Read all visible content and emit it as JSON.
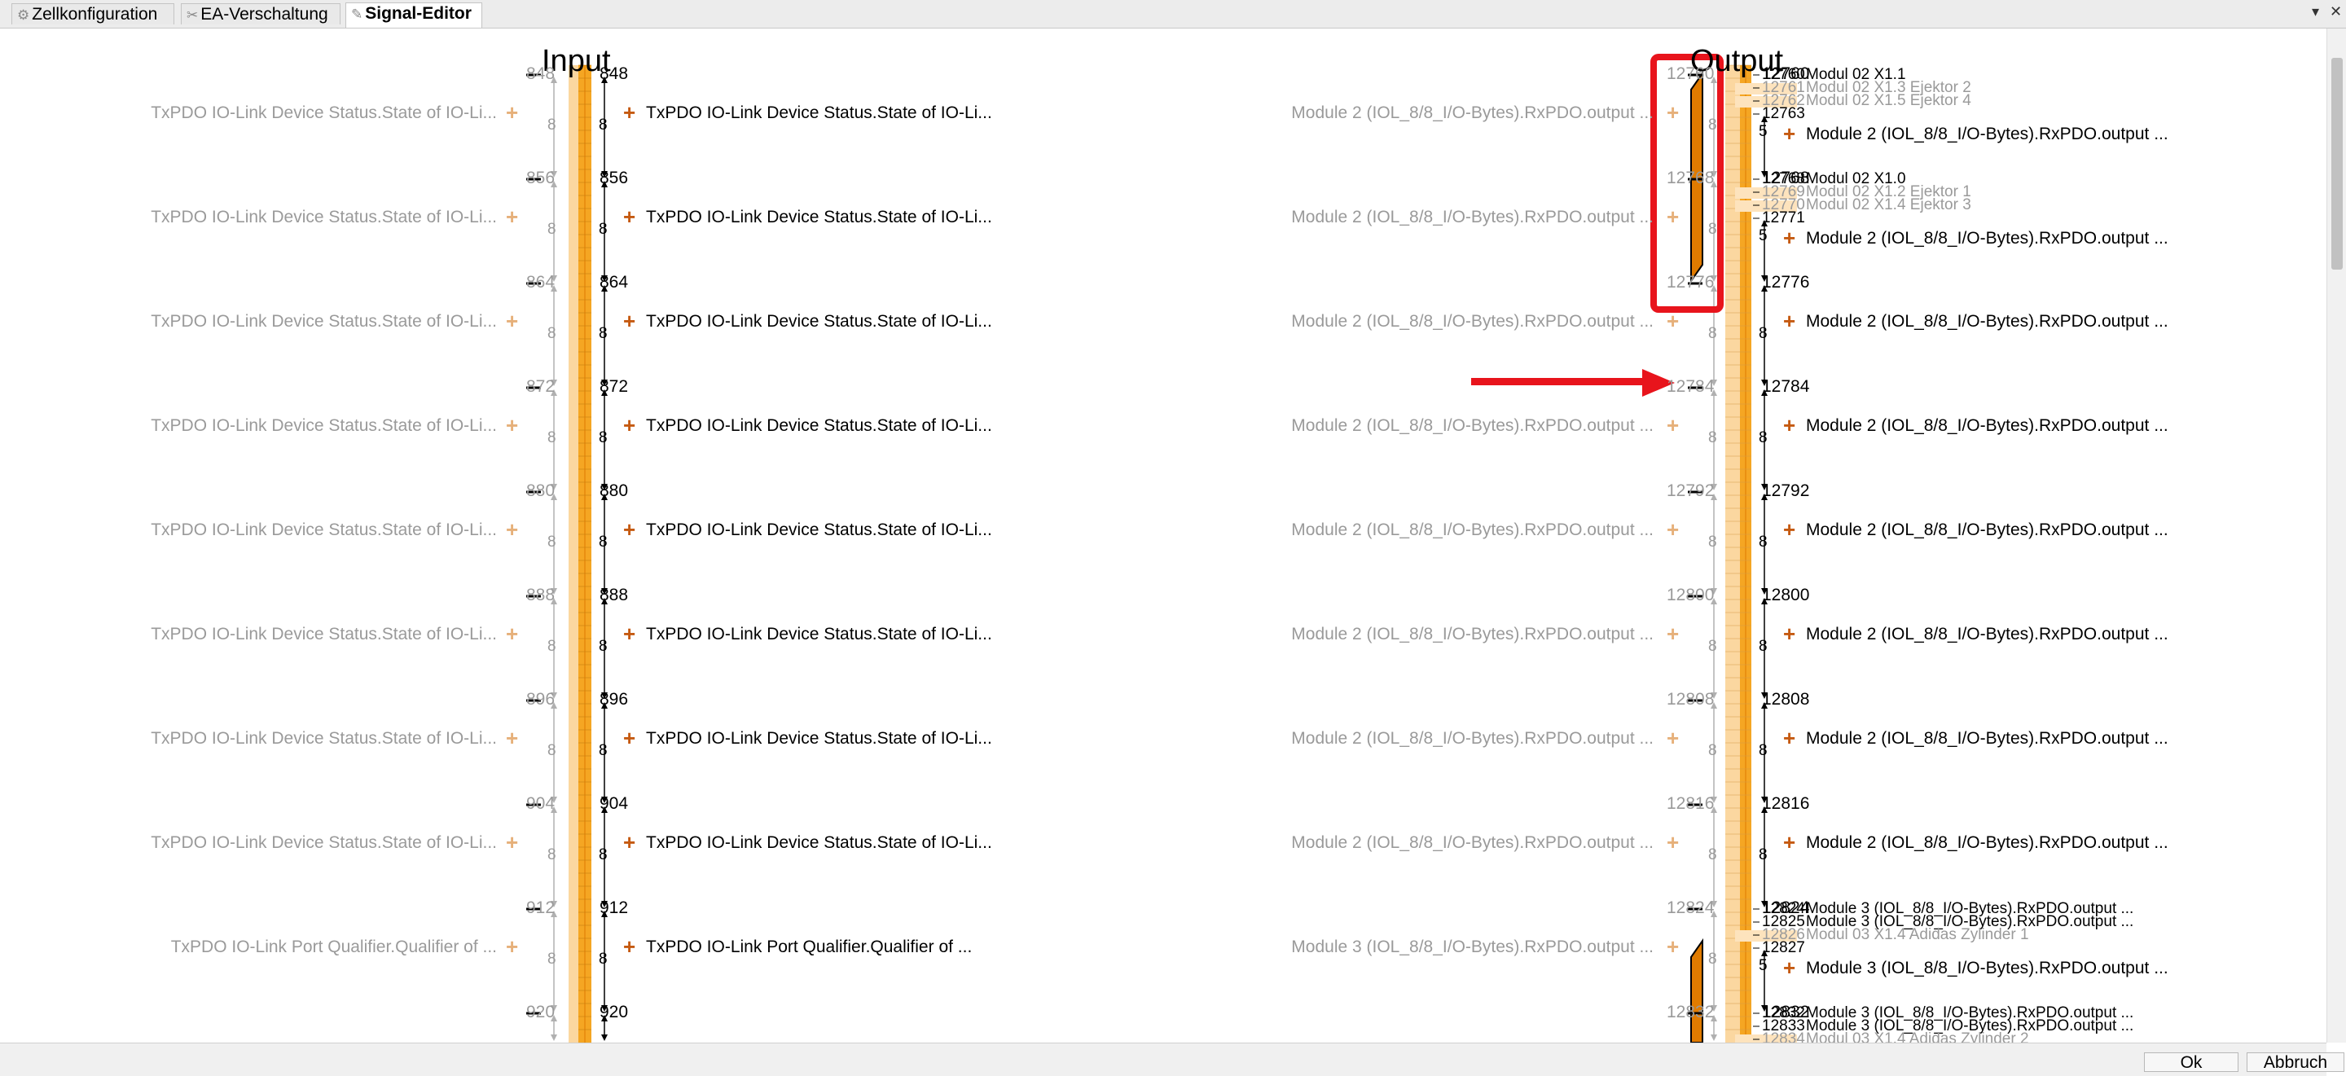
{
  "tabs": [
    {
      "icon": "⚙",
      "label": "Zellkonfiguration"
    },
    {
      "icon": "✂",
      "label": "EA-Verschaltung"
    },
    {
      "icon": "✎",
      "label": "Signal-Editor"
    }
  ],
  "window_controls": {
    "collapse": "▾",
    "close": "✕"
  },
  "headers": {
    "input": "Input",
    "output": "Output"
  },
  "input_rows": [
    {
      "start": "848",
      "width": "8",
      "left": "TxPDO IO-Link Device Status.State of IO-Li...",
      "right": "TxPDO IO-Link Device Status.State of IO-Li..."
    },
    {
      "start": "856",
      "width": "8",
      "left": "TxPDO IO-Link Device Status.State of IO-Li...",
      "right": "TxPDO IO-Link Device Status.State of IO-Li..."
    },
    {
      "start": "864",
      "width": "8",
      "left": "TxPDO IO-Link Device Status.State of IO-Li...",
      "right": "TxPDO IO-Link Device Status.State of IO-Li..."
    },
    {
      "start": "872",
      "width": "8",
      "left": "TxPDO IO-Link Device Status.State of IO-Li...",
      "right": "TxPDO IO-Link Device Status.State of IO-Li..."
    },
    {
      "start": "880",
      "width": "8",
      "left": "TxPDO IO-Link Device Status.State of IO-Li...",
      "right": "TxPDO IO-Link Device Status.State of IO-Li..."
    },
    {
      "start": "888",
      "width": "8",
      "left": "TxPDO IO-Link Device Status.State of IO-Li...",
      "right": "TxPDO IO-Link Device Status.State of IO-Li..."
    },
    {
      "start": "896",
      "width": "8",
      "left": "TxPDO IO-Link Device Status.State of IO-Li...",
      "right": "TxPDO IO-Link Device Status.State of IO-Li..."
    },
    {
      "start": "904",
      "width": "8",
      "left": "TxPDO IO-Link Device Status.State of IO-Li...",
      "right": "TxPDO IO-Link Device Status.State of IO-Li..."
    },
    {
      "start": "912",
      "width": "8",
      "left": "TxPDO IO-Link Port Qualifier.Qualifier of ...",
      "right": "TxPDO IO-Link Port Qualifier.Qualifier of ..."
    },
    {
      "start": "920",
      "width": "",
      "left": "",
      "right": ""
    }
  ],
  "output_rows": [
    {
      "start": "12760",
      "width": "8",
      "left": "Module 2 (IOL_8/8_I/O-Bytes).RxPDO.output ...",
      "right_width": "5",
      "right": "Module 2 (IOL_8/8_I/O-Bytes).RxPDO.output ...",
      "bits": [
        {
          "n": "12760",
          "label": "Modul 02 X1.1",
          "dim": false
        },
        {
          "n": "12761",
          "label": "Modul 02 X1.3 Ejektor 2",
          "dim": true
        },
        {
          "n": "12762",
          "label": "Modul 02 X1.5 Ejektor 4",
          "dim": true
        },
        {
          "n": "12763",
          "label": "",
          "dim": false
        }
      ]
    },
    {
      "start": "12768",
      "width": "8",
      "left": "Module 2 (IOL_8/8_I/O-Bytes).RxPDO.output ...",
      "right_width": "5",
      "right": "Module 2 (IOL_8/8_I/O-Bytes).RxPDO.output ...",
      "bits": [
        {
          "n": "12768",
          "label": "Modul 02 X1.0",
          "dim": false
        },
        {
          "n": "12769",
          "label": "Modul 02 X1.2 Ejektor 1",
          "dim": true
        },
        {
          "n": "12770",
          "label": "Modul 02 X1.4 Ejektor 3",
          "dim": true
        },
        {
          "n": "12771",
          "label": "",
          "dim": false
        }
      ]
    },
    {
      "start": "12776",
      "width": "8",
      "left": "Module 2 (IOL_8/8_I/O-Bytes).RxPDO.output ...",
      "right_width": "8",
      "right": "Module 2 (IOL_8/8_I/O-Bytes).RxPDO.output ...",
      "bits": []
    },
    {
      "start": "12784",
      "width": "8",
      "left": "Module 2 (IOL_8/8_I/O-Bytes).RxPDO.output ...",
      "right_width": "8",
      "right": "Module 2 (IOL_8/8_I/O-Bytes).RxPDO.output ...",
      "bits": []
    },
    {
      "start": "12792",
      "width": "8",
      "left": "Module 2 (IOL_8/8_I/O-Bytes).RxPDO.output ...",
      "right_width": "8",
      "right": "Module 2 (IOL_8/8_I/O-Bytes).RxPDO.output ...",
      "bits": []
    },
    {
      "start": "12800",
      "width": "8",
      "left": "Module 2 (IOL_8/8_I/O-Bytes).RxPDO.output ...",
      "right_width": "8",
      "right": "Module 2 (IOL_8/8_I/O-Bytes).RxPDO.output ...",
      "bits": []
    },
    {
      "start": "12808",
      "width": "8",
      "left": "Module 2 (IOL_8/8_I/O-Bytes).RxPDO.output ...",
      "right_width": "8",
      "right": "Module 2 (IOL_8/8_I/O-Bytes).RxPDO.output ...",
      "bits": []
    },
    {
      "start": "12816",
      "width": "8",
      "left": "Module 2 (IOL_8/8_I/O-Bytes).RxPDO.output ...",
      "right_width": "8",
      "right": "Module 2 (IOL_8/8_I/O-Bytes).RxPDO.output ...",
      "bits": []
    },
    {
      "start": "12824",
      "width": "8",
      "left": "Module 3 (IOL_8/8_I/O-Bytes).RxPDO.output ...",
      "right_width": "5",
      "right": "Module 3 (IOL_8/8_I/O-Bytes).RxPDO.output ...",
      "bits": [
        {
          "n": "12824",
          "label": "Module 3 (IOL_8/8_I/O-Bytes).RxPDO.output ...",
          "dim": false
        },
        {
          "n": "12825",
          "label": "Module 3 (IOL_8/8_I/O-Bytes).RxPDO.output ...",
          "dim": false
        },
        {
          "n": "12826",
          "label": "Modul 03 X1.4 Adidas Zylinder 1",
          "dim": true
        },
        {
          "n": "12827",
          "label": "",
          "dim": false
        }
      ]
    },
    {
      "start": "12832",
      "width": "",
      "left": "",
      "right_width": "",
      "right": "",
      "bits": [
        {
          "n": "12832",
          "label": "Module 3 (IOL_8/8_I/O-Bytes).RxPDO.output ...",
          "dim": false
        },
        {
          "n": "12833",
          "label": "Module 3 (IOL_8/8_I/O-Bytes).RxPDO.output ...",
          "dim": false
        },
        {
          "n": "12834",
          "label": "Modul 03 X1.4 Adidas Zylinder 2",
          "dim": true
        }
      ]
    }
  ],
  "footer": {
    "ok": "Ok",
    "cancel": "Abbruch"
  },
  "colors": {
    "bar": "#f5a623",
    "bar_light": "#fbd7a0",
    "bar_dark": "#e07b00",
    "highlight": "#e8141c"
  }
}
